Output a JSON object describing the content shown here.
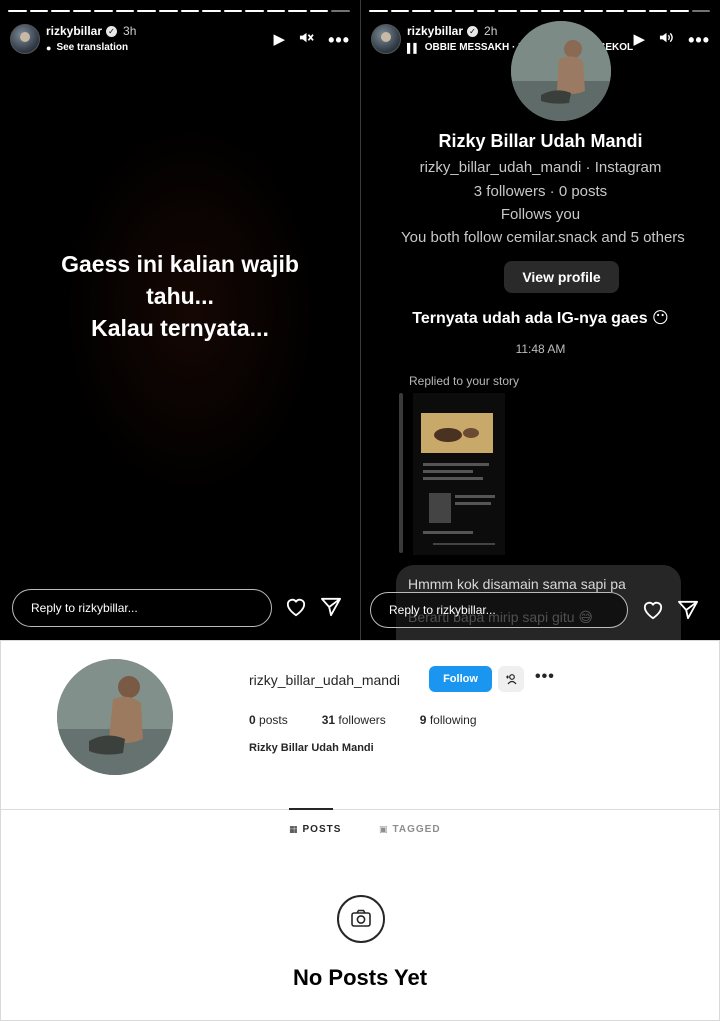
{
  "story_left": {
    "username": "rizkybillar",
    "time": "3h",
    "sub": "See translation",
    "caption_lines": [
      "Gaess ini kalian wajib",
      "tahu...",
      "Kalau ternyata..."
    ],
    "reply_placeholder": "Reply to rizkybillar..."
  },
  "story_right": {
    "username": "rizkybillar",
    "time": "2h",
    "music": "OBBIE MESSAKH · KISAH KASIH DI SEKOL",
    "dm": {
      "name": "Rizky Billar Udah Mandi",
      "handle": "rizky_billar_udah_mandi · Instagram",
      "counts": "3 followers · 0 posts",
      "follows": "Follows you",
      "mutual": "You both follow cemilar.snack and 5 others",
      "view_profile": "View profile",
      "message": "Ternyata udah ada IG-nya gaes 😶",
      "time": "11:48 AM",
      "replied": "Replied to your story",
      "bubble1": "Hmmm kok disamain sama sapi pa",
      "bubble2": "Berarti bapa mirip sapi gitu 😅"
    },
    "reply_placeholder": "Reply to rizkybillar..."
  },
  "profile": {
    "username": "rizky_billar_udah_mandi",
    "follow_label": "Follow",
    "posts_count": "0",
    "posts_label": "posts",
    "followers_count": "31",
    "followers_label": "followers",
    "following_count": "9",
    "following_label": "following",
    "full_name": "Rizky Billar Udah Mandi",
    "tab_posts": "POSTS",
    "tab_tagged": "TAGGED",
    "empty_title": "No Posts Yet"
  },
  "icons": {
    "play": "play-icon",
    "mute": "mute-icon",
    "volume": "volume-icon",
    "more": "more-icon",
    "heart": "heart-icon",
    "send": "send-icon",
    "camera": "camera-icon",
    "grid": "grid-icon",
    "tag": "tag-icon",
    "add_person": "add-person-icon"
  },
  "colors": {
    "follow_button": "#1a96f0",
    "story_bg": "#000000",
    "dm_bubble": "#262626"
  }
}
